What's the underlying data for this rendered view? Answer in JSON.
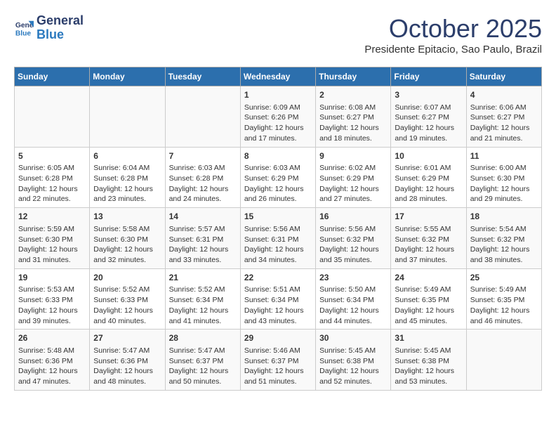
{
  "header": {
    "logo_line1": "General",
    "logo_line2": "Blue",
    "month": "October 2025",
    "location": "Presidente Epitacio, Sao Paulo, Brazil"
  },
  "days_of_week": [
    "Sunday",
    "Monday",
    "Tuesday",
    "Wednesday",
    "Thursday",
    "Friday",
    "Saturday"
  ],
  "weeks": [
    [
      {
        "day": "",
        "info": ""
      },
      {
        "day": "",
        "info": ""
      },
      {
        "day": "",
        "info": ""
      },
      {
        "day": "1",
        "info": "Sunrise: 6:09 AM\nSunset: 6:26 PM\nDaylight: 12 hours\nand 17 minutes."
      },
      {
        "day": "2",
        "info": "Sunrise: 6:08 AM\nSunset: 6:27 PM\nDaylight: 12 hours\nand 18 minutes."
      },
      {
        "day": "3",
        "info": "Sunrise: 6:07 AM\nSunset: 6:27 PM\nDaylight: 12 hours\nand 19 minutes."
      },
      {
        "day": "4",
        "info": "Sunrise: 6:06 AM\nSunset: 6:27 PM\nDaylight: 12 hours\nand 21 minutes."
      }
    ],
    [
      {
        "day": "5",
        "info": "Sunrise: 6:05 AM\nSunset: 6:28 PM\nDaylight: 12 hours\nand 22 minutes."
      },
      {
        "day": "6",
        "info": "Sunrise: 6:04 AM\nSunset: 6:28 PM\nDaylight: 12 hours\nand 23 minutes."
      },
      {
        "day": "7",
        "info": "Sunrise: 6:03 AM\nSunset: 6:28 PM\nDaylight: 12 hours\nand 24 minutes."
      },
      {
        "day": "8",
        "info": "Sunrise: 6:03 AM\nSunset: 6:29 PM\nDaylight: 12 hours\nand 26 minutes."
      },
      {
        "day": "9",
        "info": "Sunrise: 6:02 AM\nSunset: 6:29 PM\nDaylight: 12 hours\nand 27 minutes."
      },
      {
        "day": "10",
        "info": "Sunrise: 6:01 AM\nSunset: 6:29 PM\nDaylight: 12 hours\nand 28 minutes."
      },
      {
        "day": "11",
        "info": "Sunrise: 6:00 AM\nSunset: 6:30 PM\nDaylight: 12 hours\nand 29 minutes."
      }
    ],
    [
      {
        "day": "12",
        "info": "Sunrise: 5:59 AM\nSunset: 6:30 PM\nDaylight: 12 hours\nand 31 minutes."
      },
      {
        "day": "13",
        "info": "Sunrise: 5:58 AM\nSunset: 6:30 PM\nDaylight: 12 hours\nand 32 minutes."
      },
      {
        "day": "14",
        "info": "Sunrise: 5:57 AM\nSunset: 6:31 PM\nDaylight: 12 hours\nand 33 minutes."
      },
      {
        "day": "15",
        "info": "Sunrise: 5:56 AM\nSunset: 6:31 PM\nDaylight: 12 hours\nand 34 minutes."
      },
      {
        "day": "16",
        "info": "Sunrise: 5:56 AM\nSunset: 6:32 PM\nDaylight: 12 hours\nand 35 minutes."
      },
      {
        "day": "17",
        "info": "Sunrise: 5:55 AM\nSunset: 6:32 PM\nDaylight: 12 hours\nand 37 minutes."
      },
      {
        "day": "18",
        "info": "Sunrise: 5:54 AM\nSunset: 6:32 PM\nDaylight: 12 hours\nand 38 minutes."
      }
    ],
    [
      {
        "day": "19",
        "info": "Sunrise: 5:53 AM\nSunset: 6:33 PM\nDaylight: 12 hours\nand 39 minutes."
      },
      {
        "day": "20",
        "info": "Sunrise: 5:52 AM\nSunset: 6:33 PM\nDaylight: 12 hours\nand 40 minutes."
      },
      {
        "day": "21",
        "info": "Sunrise: 5:52 AM\nSunset: 6:34 PM\nDaylight: 12 hours\nand 41 minutes."
      },
      {
        "day": "22",
        "info": "Sunrise: 5:51 AM\nSunset: 6:34 PM\nDaylight: 12 hours\nand 43 minutes."
      },
      {
        "day": "23",
        "info": "Sunrise: 5:50 AM\nSunset: 6:34 PM\nDaylight: 12 hours\nand 44 minutes."
      },
      {
        "day": "24",
        "info": "Sunrise: 5:49 AM\nSunset: 6:35 PM\nDaylight: 12 hours\nand 45 minutes."
      },
      {
        "day": "25",
        "info": "Sunrise: 5:49 AM\nSunset: 6:35 PM\nDaylight: 12 hours\nand 46 minutes."
      }
    ],
    [
      {
        "day": "26",
        "info": "Sunrise: 5:48 AM\nSunset: 6:36 PM\nDaylight: 12 hours\nand 47 minutes."
      },
      {
        "day": "27",
        "info": "Sunrise: 5:47 AM\nSunset: 6:36 PM\nDaylight: 12 hours\nand 48 minutes."
      },
      {
        "day": "28",
        "info": "Sunrise: 5:47 AM\nSunset: 6:37 PM\nDaylight: 12 hours\nand 50 minutes."
      },
      {
        "day": "29",
        "info": "Sunrise: 5:46 AM\nSunset: 6:37 PM\nDaylight: 12 hours\nand 51 minutes."
      },
      {
        "day": "30",
        "info": "Sunrise: 5:45 AM\nSunset: 6:38 PM\nDaylight: 12 hours\nand 52 minutes."
      },
      {
        "day": "31",
        "info": "Sunrise: 5:45 AM\nSunset: 6:38 PM\nDaylight: 12 hours\nand 53 minutes."
      },
      {
        "day": "",
        "info": ""
      }
    ]
  ]
}
